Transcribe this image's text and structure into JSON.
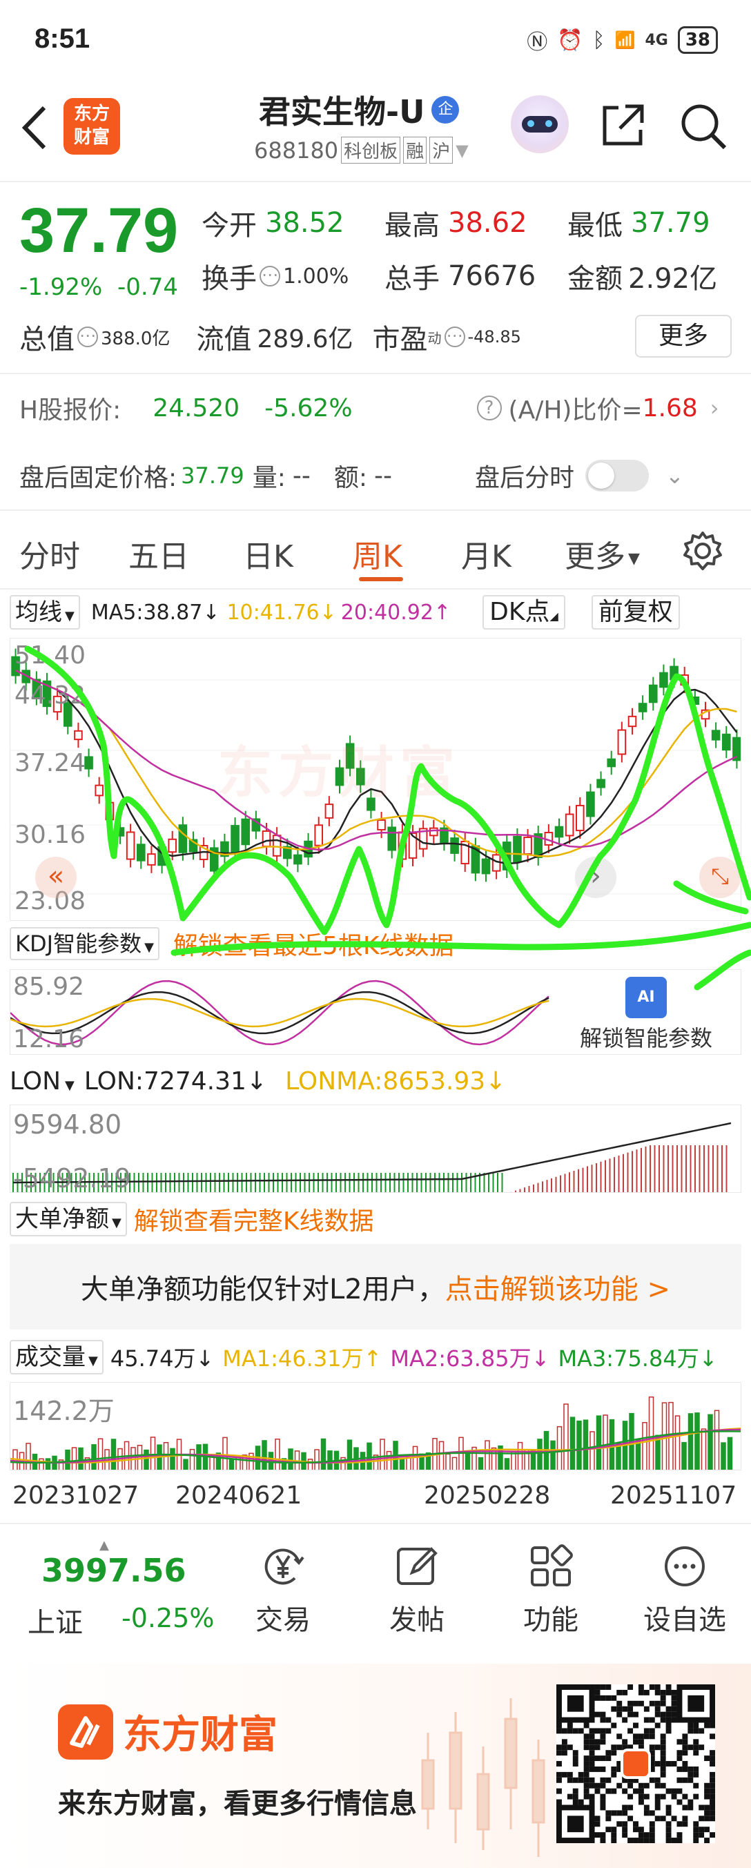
{
  "status_bar": {
    "time": "8:51",
    "network": "4G",
    "battery": "38"
  },
  "header": {
    "logo_line1": "东方",
    "logo_line2": "财富",
    "title": "君实生物-U",
    "badge": "企",
    "code": "688180",
    "tags": [
      "科创板",
      "融",
      "沪"
    ]
  },
  "quote": {
    "price": "37.79",
    "change_pct": "-1.92%",
    "change": "-0.74",
    "fields": [
      {
        "label": "今开",
        "value": "38.52",
        "color": "green"
      },
      {
        "label": "最高",
        "value": "38.62",
        "color": "red"
      },
      {
        "label": "最低",
        "value": "37.79",
        "color": "green"
      },
      {
        "label": "换手",
        "value": "1.00%",
        "color": "dark"
      },
      {
        "label": "总手",
        "value": "76676",
        "color": "dark"
      },
      {
        "label": "金额",
        "value": "2.92亿",
        "color": "dark"
      }
    ],
    "total_value_label": "总值",
    "total_value": "388.0亿",
    "float_label": "流值",
    "float_value": "289.6亿",
    "pe_label": "市盈",
    "pe_sup": "动",
    "pe_value": "-48.85",
    "more_button": "更多"
  },
  "h_share": {
    "label": "H股报价:",
    "price": "24.520",
    "pct": "-5.62%",
    "ratio_label": "(A/H)比价=",
    "ratio_value": "1.68"
  },
  "after_hours": {
    "label": "盘后固定价格:",
    "price": "37.79",
    "vol_label": "量:",
    "vol": "--",
    "amt_label": "额:",
    "amt": "--",
    "timeshare_label": "盘后分时"
  },
  "tabs": [
    "分时",
    "五日",
    "日K",
    "周K",
    "月K",
    "更多"
  ],
  "active_tab": "周K",
  "kline": {
    "ma_selector": "均线",
    "ma5": "MA5:38.87↓",
    "ma10": "10:41.76↓",
    "ma20": "20:40.92↑",
    "dk_button": "DK点",
    "adjust_button": "前复权",
    "y_ticks": [
      "51.40",
      "44.32",
      "37.24",
      "30.16",
      "23.08"
    ],
    "watermark": "东方财富",
    "unlock_text": "解锁查看最近5根K线数据"
  },
  "kdj": {
    "selector": "KDJ智能参数",
    "y_top": "85.92",
    "y_bottom": "12.16",
    "unlock_label": "解锁智能参数",
    "ai_badge": "AI"
  },
  "lon": {
    "selector": "LON",
    "lon_value": "LON:7274.31↓",
    "lonma_value": "LONMA:8653.93↓",
    "y_top": "9594.80",
    "y_bottom": "-5492.19"
  },
  "big_order": {
    "selector": "大单净额",
    "unlock_text": "解锁查看完整K线数据",
    "notice_text": "大单净额功能仅针对L2用户，",
    "notice_link": "点击解锁该功能 >"
  },
  "volume": {
    "selector": "成交量",
    "value": "45.74万↓",
    "ma1": "MA1:46.31万↑",
    "ma2": "MA2:63.85万↓",
    "ma3": "MA3:75.84万↓",
    "y_top": "142.2万",
    "dates": [
      "20231027",
      "20240621",
      "20250228",
      "20251107"
    ]
  },
  "bottom_nav": {
    "index_value": "3997.56",
    "index_name": "上证",
    "index_pct": "-0.25%",
    "items": [
      {
        "label": "交易",
        "icon": "yen-icon"
      },
      {
        "label": "发帖",
        "icon": "edit-icon"
      },
      {
        "label": "功能",
        "icon": "grid-icon"
      },
      {
        "label": "设自选",
        "icon": "more-icon"
      }
    ]
  },
  "footer": {
    "brand": "东方财富",
    "slogan": "来东方财富，看更多行情信息"
  },
  "colors": {
    "up": "#e02020",
    "down": "#1a9a2a",
    "accent": "#f07000",
    "highlight_scribble": "#33ee22"
  }
}
